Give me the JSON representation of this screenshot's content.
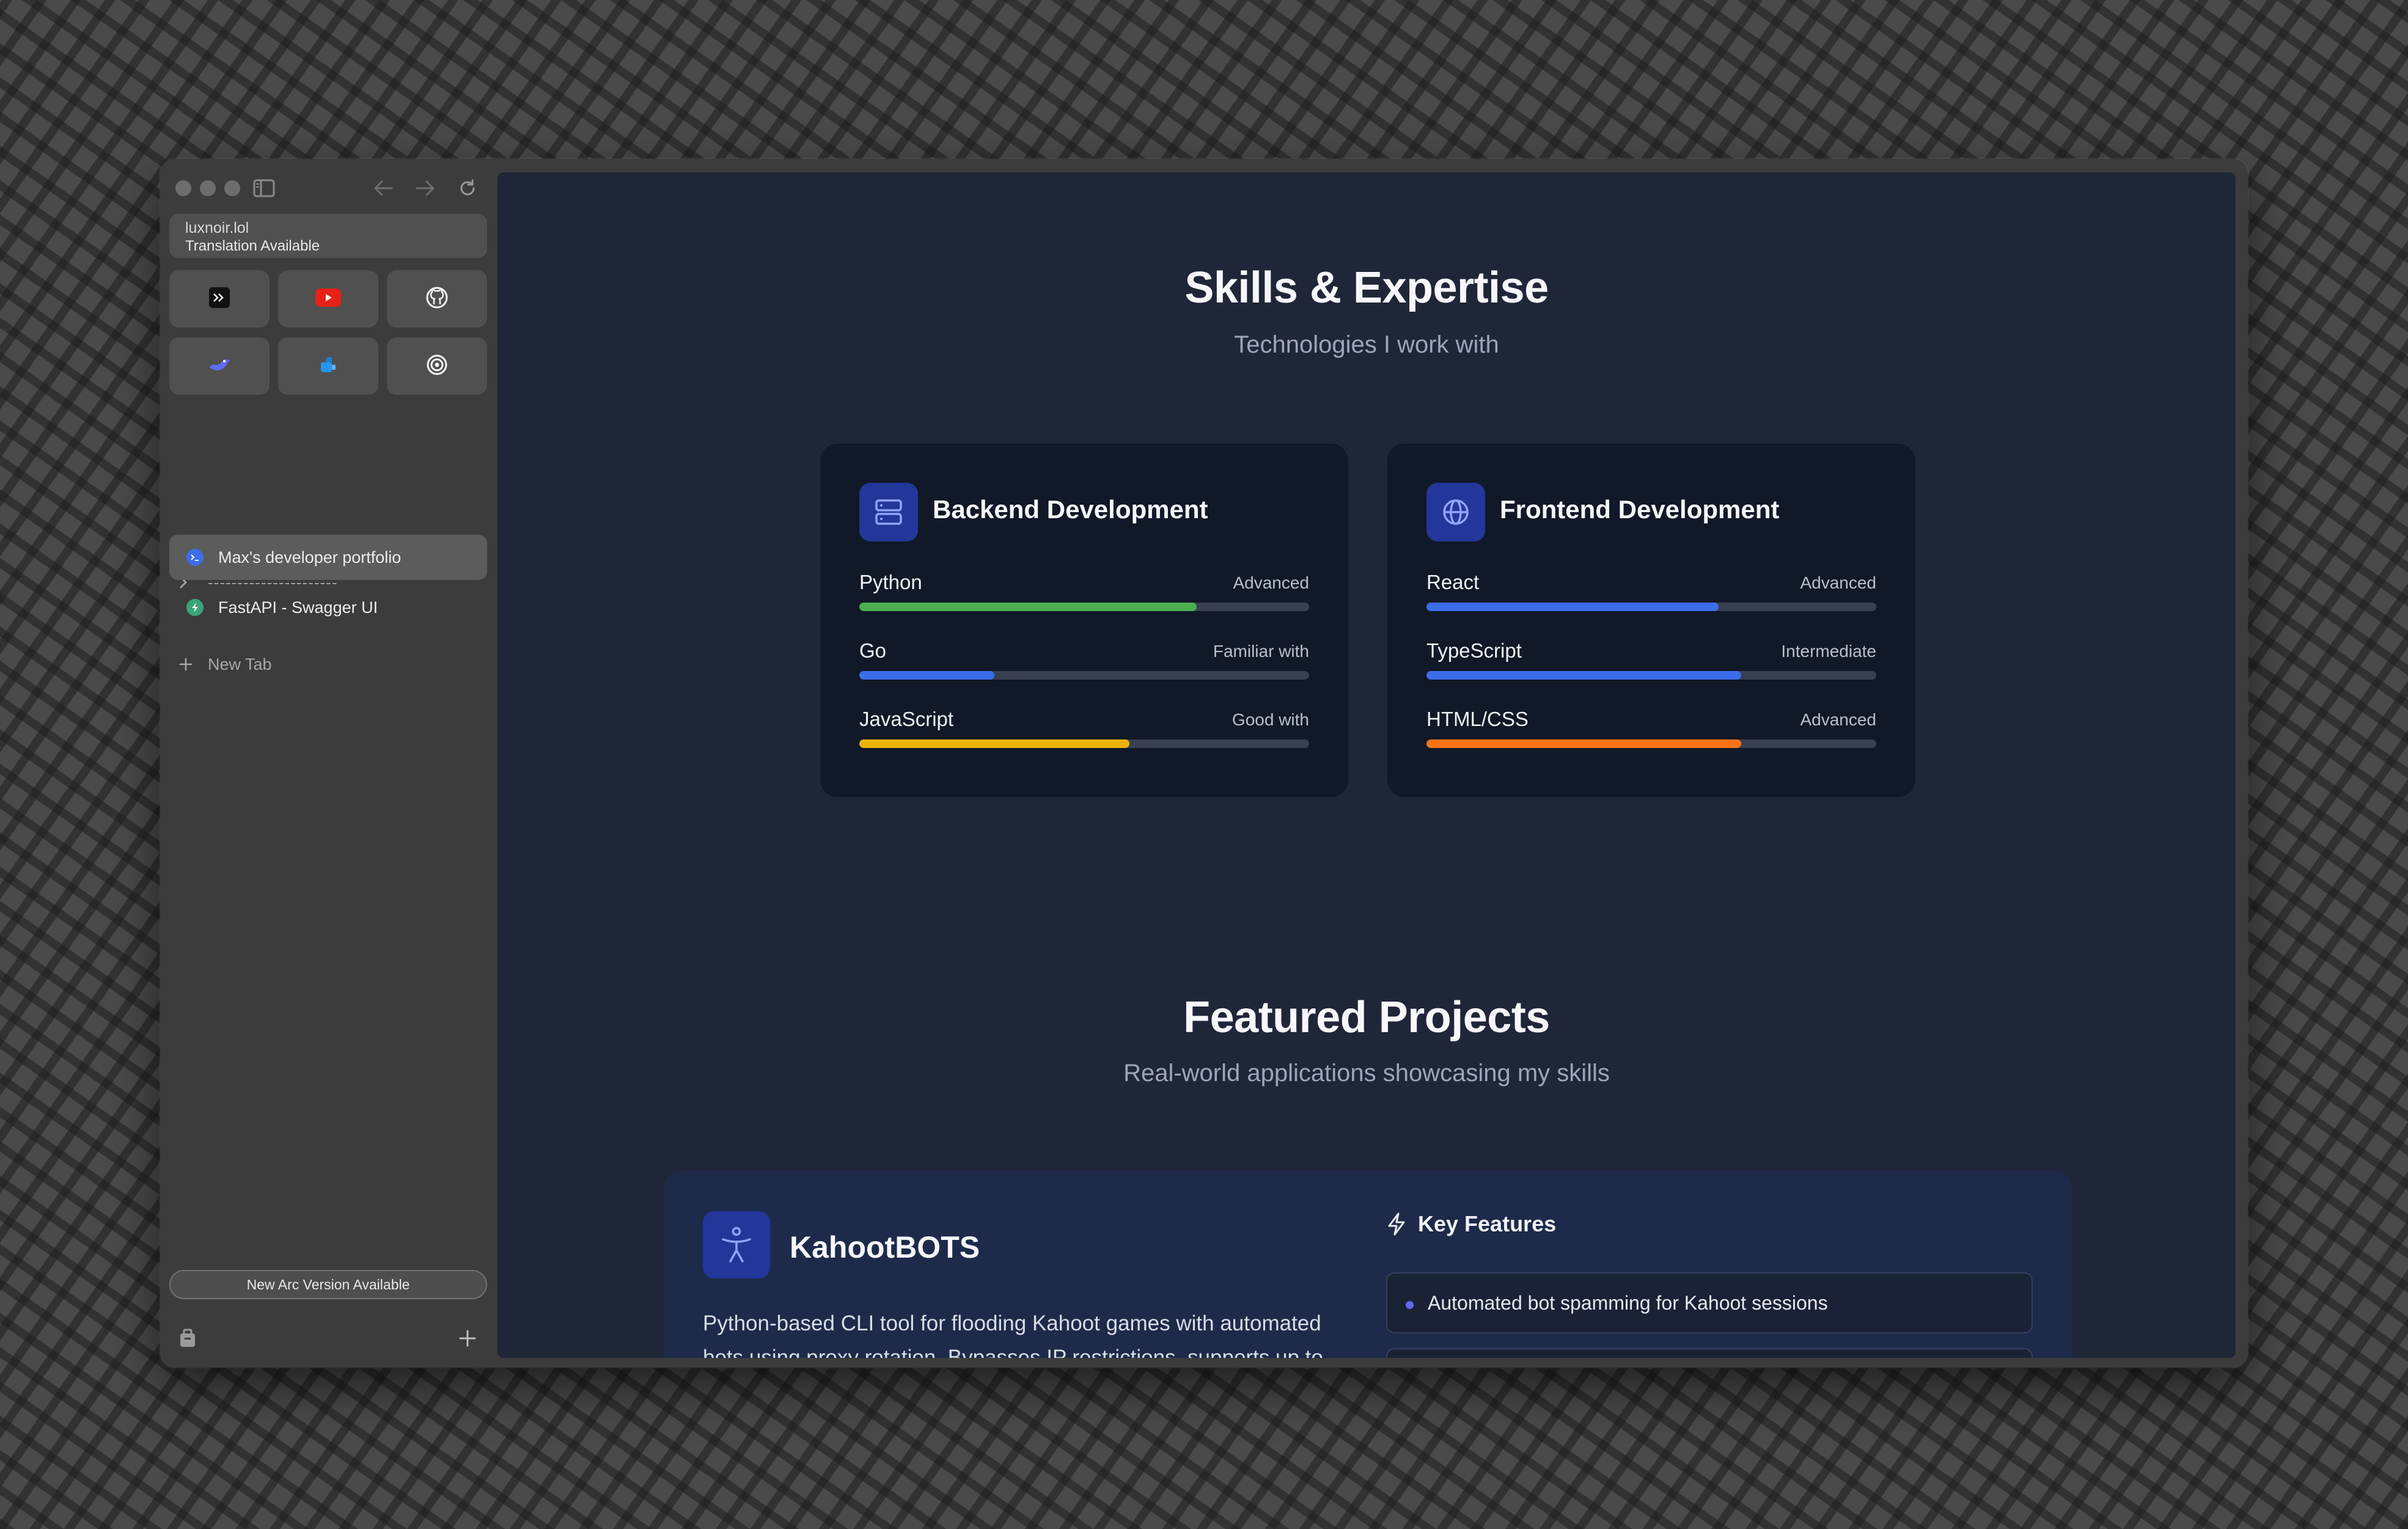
{
  "sidebar": {
    "url": {
      "domain": "luxnoir.lol",
      "subtitle": "Translation Available"
    },
    "favorites": [
      {
        "name": "terminal-app"
      },
      {
        "name": "youtube"
      },
      {
        "name": "github"
      },
      {
        "name": "bird-app"
      },
      {
        "name": "docker"
      },
      {
        "name": "target-app"
      }
    ],
    "folder_label": "----------------------",
    "new_tab_label": "New Tab",
    "tabs": [
      {
        "title": "Max's developer portfolio",
        "active": true
      },
      {
        "title": "FastAPI - Swagger UI",
        "active": false
      }
    ],
    "update_label": "New Arc Version Available"
  },
  "skills": {
    "title": "Skills & Expertise",
    "subtitle": "Technologies I work with",
    "backend": {
      "title": "Backend Development",
      "items": [
        {
          "name": "Python",
          "level": "Advanced",
          "percent": 75,
          "color": "#4caf50"
        },
        {
          "name": "Go",
          "level": "Familiar with",
          "percent": 30,
          "color": "#3b6ee8"
        },
        {
          "name": "JavaScript",
          "level": "Good with",
          "percent": 60,
          "color": "#eab308"
        }
      ]
    },
    "frontend": {
      "title": "Frontend Development",
      "items": [
        {
          "name": "React",
          "level": "Advanced",
          "percent": 65,
          "color": "#3b6ee8"
        },
        {
          "name": "TypeScript",
          "level": "Intermediate",
          "percent": 70,
          "color": "#3b6ee8"
        },
        {
          "name": "HTML/CSS",
          "level": "Advanced",
          "percent": 70,
          "color": "#f97316"
        }
      ]
    }
  },
  "projects": {
    "title": "Featured Projects",
    "subtitle": "Real-world applications showcasing my skills",
    "featured": {
      "name": "KahootBOTS",
      "description": "Python-based CLI tool for flooding Kahoot games with automated bots using proxy rotation. Bypasses IP restrictions, supports up to",
      "key_features_title": "Key Features",
      "features": [
        "Automated bot spamming for Kahoot sessions"
      ]
    }
  }
}
